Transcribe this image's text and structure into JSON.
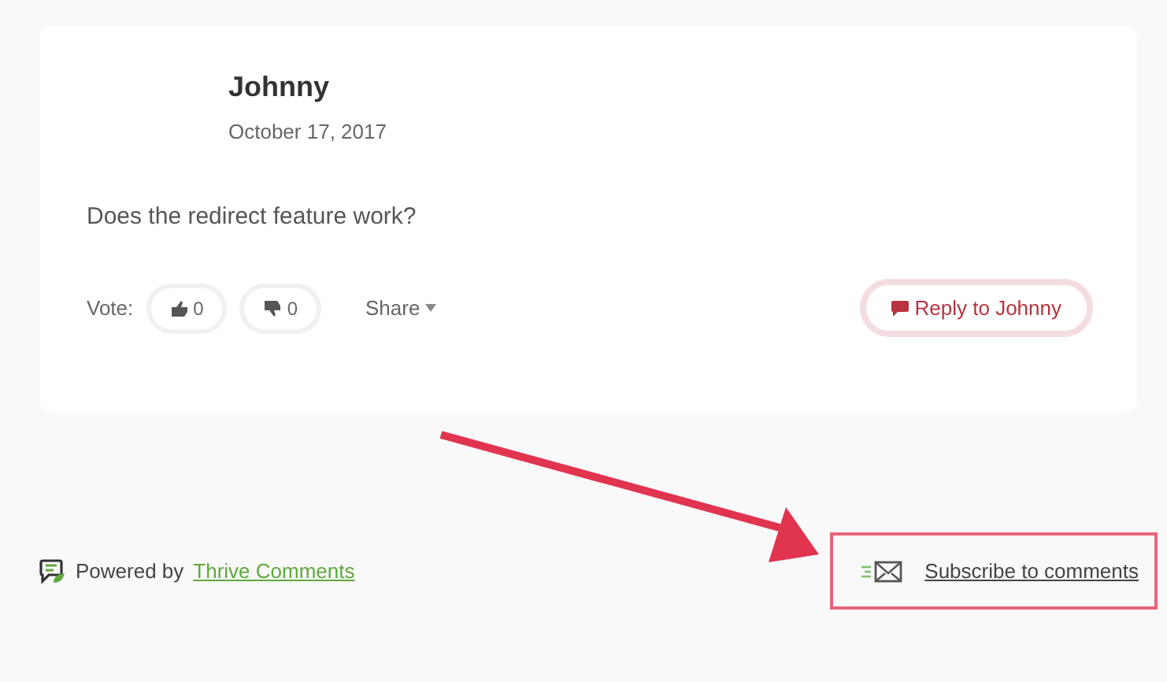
{
  "comment": {
    "author": "Johnny",
    "date": "October 17, 2017",
    "text": "Does the redirect feature work?",
    "vote_label": "Vote:",
    "upvotes": "0",
    "downvotes": "0",
    "share": "Share",
    "reply_button": "Reply to Johnny"
  },
  "footer": {
    "powered_by": "Powered by",
    "powered_link": "Thrive Comments",
    "subscribe_link": "Subscribe to comments"
  }
}
